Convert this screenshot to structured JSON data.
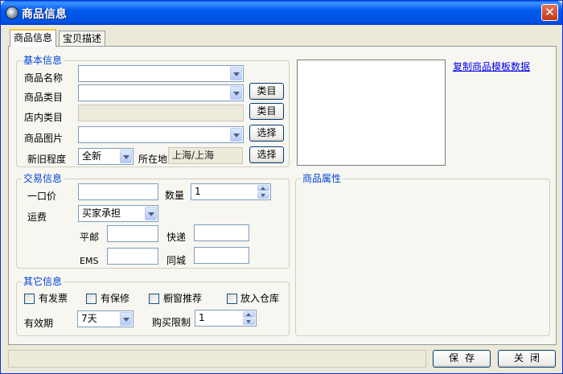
{
  "window": {
    "title": "商品信息",
    "close_glyph": "✕"
  },
  "tabs": [
    "商品信息",
    "宝贝描述"
  ],
  "basic_info": {
    "title": "基本信息",
    "name_label": "商品名称",
    "category_label": "商品类目",
    "category_button": "类目",
    "store_category_label": "店内类目",
    "store_category_button": "类目",
    "image_label": "商品图片",
    "image_button": "选择",
    "condition_label": "新旧程度",
    "condition_value": "全新",
    "location_label": "所在地",
    "location_value": "上海/上海",
    "location_button": "选择"
  },
  "copy_template_link": "复制商品模板数据",
  "trade_info": {
    "title": "交易信息",
    "price_label": "一口价",
    "quantity_label": "数量",
    "quantity_value": "1",
    "shipping_label": "运费",
    "shipping_value": "买家承担",
    "post_label": "平邮",
    "express_label": "快递",
    "ems_label": "EMS",
    "local_label": "同城"
  },
  "attributes": {
    "title": "商品属性"
  },
  "other_info": {
    "title": "其它信息",
    "invoice_label": "有发票",
    "warranty_label": "有保修",
    "window_label": "橱窗推荐",
    "warehouse_label": "放入仓库",
    "validity_label": "有效期",
    "validity_value": "7天",
    "limit_label": "购买限制",
    "limit_value": "1"
  },
  "footer": {
    "save_button": "保存",
    "close_button": "关闭"
  },
  "colors": {
    "title_bar": "#0054e3",
    "group_title": "#0046d5",
    "link": "#0000ee"
  }
}
